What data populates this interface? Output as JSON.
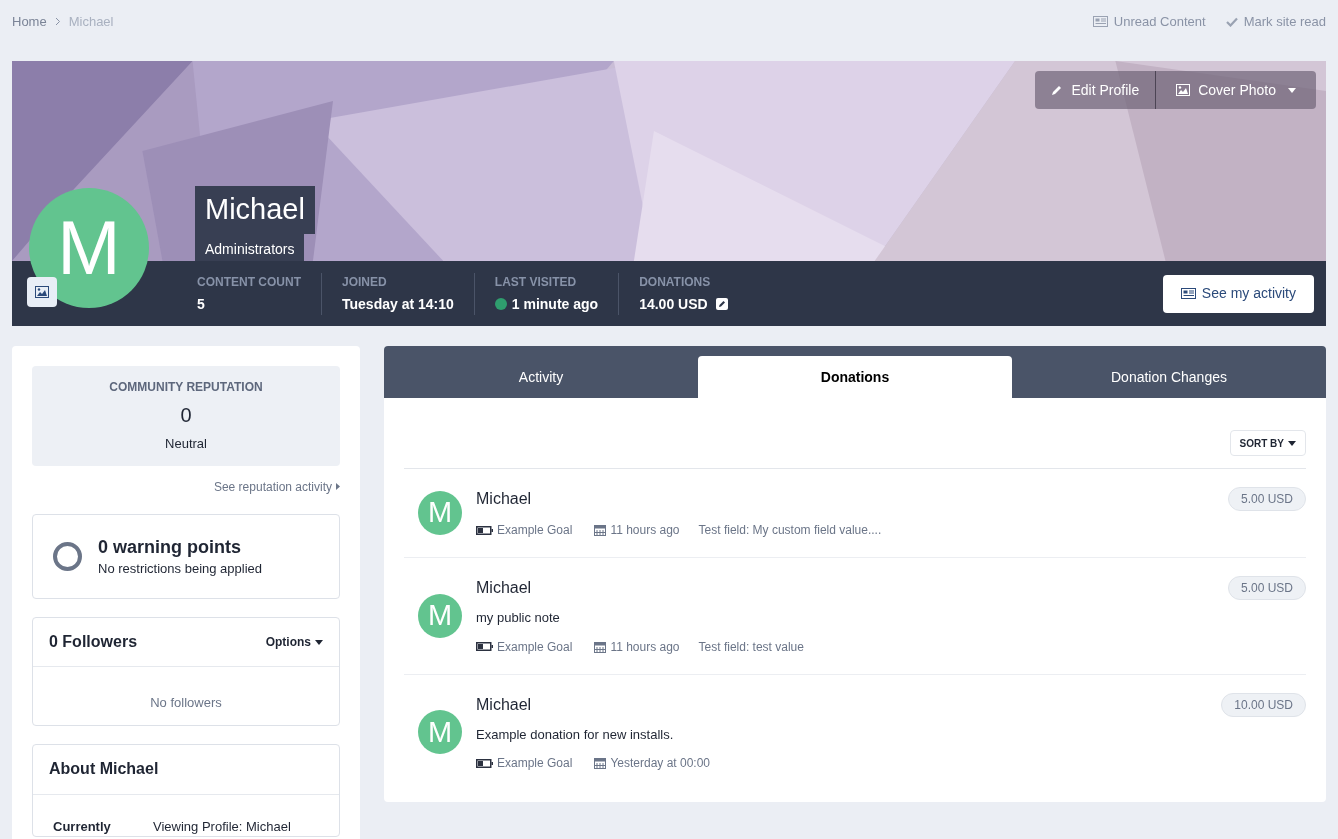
{
  "breadcrumb": [
    {
      "label": "Home",
      "current": false
    },
    {
      "label": "Michael",
      "current": true
    }
  ],
  "top_links": [
    {
      "kind": "unread",
      "label": "Unread Content"
    },
    {
      "kind": "read",
      "label": "Mark site read"
    }
  ],
  "profile": {
    "name": "Michael",
    "group": "Administrators",
    "avatar_letter": "M",
    "header_buttons": [
      {
        "kind": "edit",
        "label": "Edit Profile"
      },
      {
        "kind": "cover",
        "label": "Cover Photo"
      }
    ],
    "stats": [
      {
        "label": "CONTENT COUNT",
        "value": "5",
        "online": false,
        "editable": false
      },
      {
        "label": "JOINED",
        "value": "Tuesday at 14:10",
        "online": false,
        "editable": false
      },
      {
        "label": "LAST VISITED",
        "value": "1 minute ago",
        "online": true,
        "editable": false
      },
      {
        "label": "DONATIONS",
        "value": "14.00 USD",
        "online": false,
        "editable": true
      }
    ],
    "activity_button": "See my activity"
  },
  "reputation": {
    "title": "COMMUNITY REPUTATION",
    "value": "0",
    "label": "Neutral",
    "link": "See reputation activity"
  },
  "warnings": {
    "title": "0 warning points",
    "subtitle": "No restrictions being applied"
  },
  "followers": {
    "title": "0 Followers",
    "options": "Options",
    "empty": "No followers"
  },
  "about": {
    "title": "About Michael",
    "rows": [
      {
        "label": "Currently",
        "value": "Viewing Profile: Michael"
      }
    ]
  },
  "tabs": [
    {
      "label": "Activity",
      "selected": false
    },
    {
      "label": "Donations",
      "selected": true
    },
    {
      "label": "Donation Changes",
      "selected": false
    }
  ],
  "sort_button": "SORT BY",
  "donations": [
    {
      "avatar_letter": "M",
      "name": "Michael",
      "goal": "Example Goal",
      "time": "11 hours ago",
      "field": "Test field: My custom field value....",
      "amount": "5.00 USD"
    },
    {
      "avatar_letter": "M",
      "name": "Michael",
      "note": "my public note",
      "goal": "Example Goal",
      "time": "11 hours ago",
      "field": "Test field: test value",
      "amount": "5.00 USD"
    },
    {
      "avatar_letter": "M",
      "name": "Michael",
      "note": "Example donation for new installs.",
      "goal": "Example Goal",
      "time": "Yesterday at 00:00",
      "amount": "10.00 USD"
    }
  ]
}
